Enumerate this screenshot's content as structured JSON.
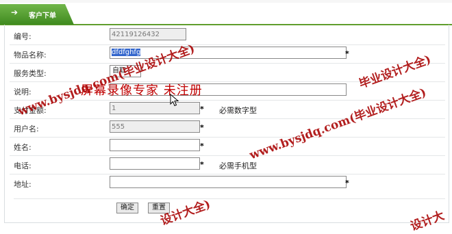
{
  "tab": {
    "title": "客户下单",
    "icon": "right-arrow-icon"
  },
  "form": {
    "rows": [
      {
        "label": "编号:",
        "value": "42119126432"
      },
      {
        "label": "物品名称:",
        "value": "dfdfghfg"
      },
      {
        "label": "服务类型:",
        "value": "自取"
      },
      {
        "label": "说明:",
        "value": ""
      },
      {
        "label": "支付金额:",
        "value": "1",
        "hint": "必需数字型"
      },
      {
        "label": "用户名:",
        "value": "555"
      },
      {
        "label": "姓名:",
        "value": ""
      },
      {
        "label": "电话:",
        "value": "",
        "hint": "必需手机型"
      },
      {
        "label": "地址:",
        "value": ""
      }
    ],
    "required_mark": "*",
    "buttons": {
      "confirm": "确定",
      "reset": "重置"
    }
  },
  "overlay_text": "屏幕录像专家 未注册",
  "watermarks": [
    "www.bysjdq.com(毕业设计大全)",
    "www.bysjdq.com(毕业设计大全)",
    "毕业设计大全)",
    "设计大全)",
    "设计大"
  ],
  "colors": {
    "tab_green": "#5f9e2c",
    "watermark_red": "#a80000",
    "selection_blue": "#3366cc"
  }
}
